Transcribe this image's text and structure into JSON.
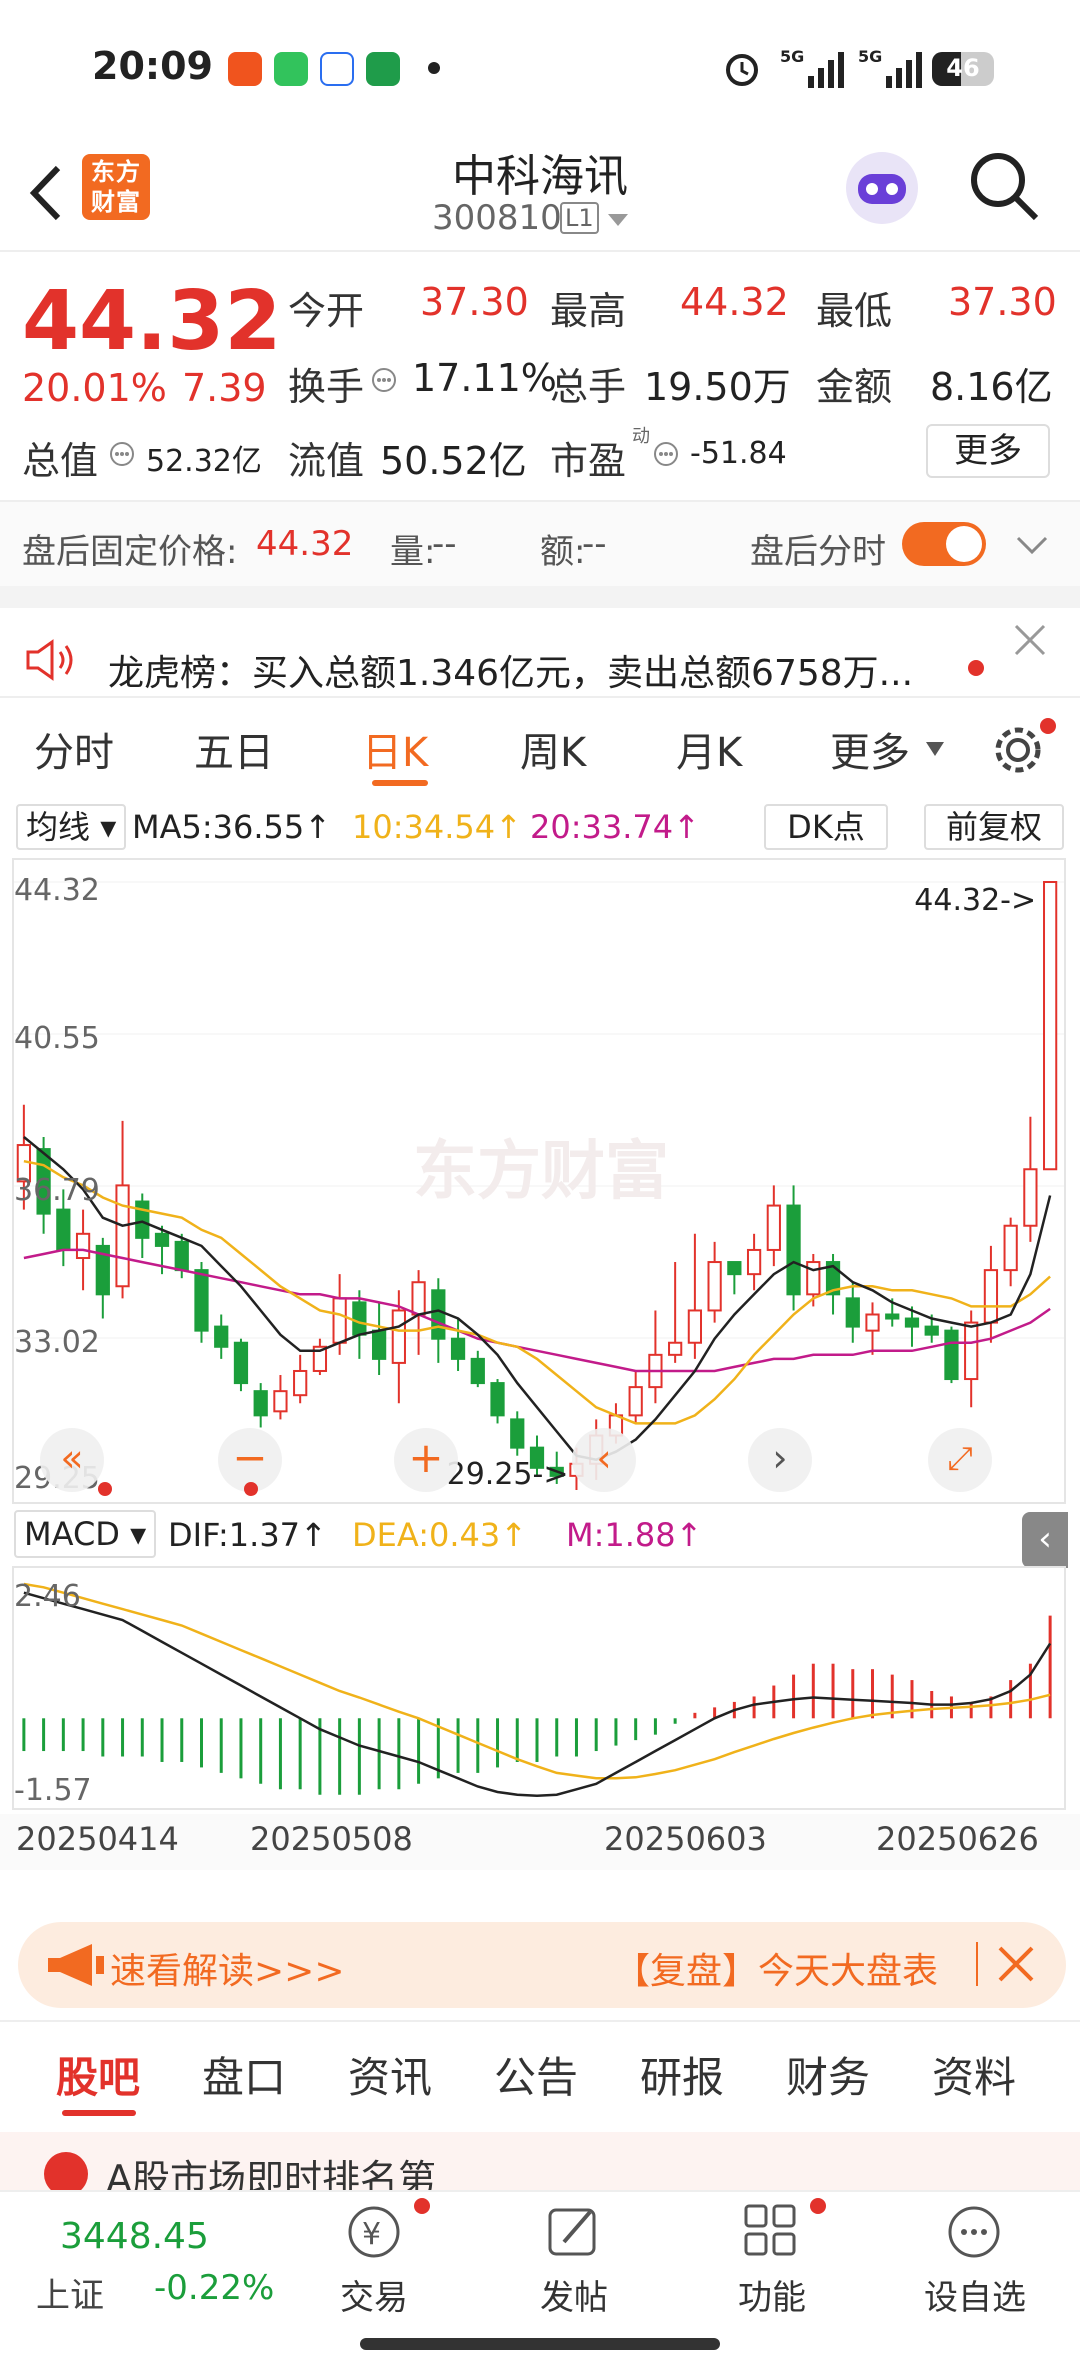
{
  "status": {
    "time": "20:09",
    "battery": "46"
  },
  "header": {
    "logo_text": "东方财富",
    "stock_name": "中科海讯",
    "stock_code": "300810",
    "level_badge": "L1"
  },
  "quote": {
    "price": "44.32",
    "change_pct": "20.01%",
    "change_amt": "7.39",
    "open_label": "今开",
    "open": "37.30",
    "high_label": "最高",
    "high": "44.32",
    "low_label": "最低",
    "low": "37.30",
    "turnover_label": "换手",
    "turnover": "17.11%",
    "volume_label": "总手",
    "volume": "19.50万",
    "amount_label": "金额",
    "amount": "8.16亿",
    "mktcap_label": "总值",
    "mktcap": "52.32亿",
    "float_label": "流值",
    "float_cap": "50.52亿",
    "pe_label": "市盈",
    "pe_sup": "动",
    "pe": "-51.84",
    "more_button": "更多"
  },
  "afterhours": {
    "label": "盘后固定价格:",
    "price": "44.32",
    "vol_label": "量:",
    "vol": "--",
    "amt_label": "额:",
    "amt": "--",
    "toggle_label": "盘后分时",
    "toggle_on": true
  },
  "notice": {
    "text": "龙虎榜：买入总额1.346亿元，卖出总额6758万..."
  },
  "tabs": [
    {
      "label": "分时",
      "active": false
    },
    {
      "label": "五日",
      "active": false
    },
    {
      "label": "日K",
      "active": true
    },
    {
      "label": "周K",
      "active": false
    },
    {
      "label": "月K",
      "active": false
    },
    {
      "label": "更多",
      "active": false
    }
  ],
  "ma_bar": {
    "select": "均线",
    "ma5": "MA5:36.55↑",
    "ma10": "10:34.54↑",
    "ma20": "20:33.74↑",
    "dk": "DK点",
    "fq": "前复权"
  },
  "chart_data": {
    "type": "candlestick",
    "watermark": "东方财富",
    "y_ticks": [
      "44.32",
      "40.55",
      "36.79",
      "33.02",
      "29.25"
    ],
    "ylim": [
      29.25,
      44.32
    ],
    "max_label": "44.32->",
    "min_label": "29.25->",
    "x_ticks": [
      "20250414",
      "20250508",
      "20250603",
      "20250626"
    ],
    "candles": [
      [
        36.9,
        37.8,
        38.8,
        36.2
      ],
      [
        37.7,
        36.1,
        38.0,
        35.6
      ],
      [
        36.2,
        35.2,
        36.7,
        34.8
      ],
      [
        35.0,
        35.6,
        36.2,
        34.2
      ],
      [
        35.3,
        34.1,
        35.5,
        33.5
      ],
      [
        34.3,
        36.8,
        38.4,
        34.0
      ],
      [
        36.4,
        35.5,
        36.6,
        35.0
      ],
      [
        35.6,
        35.3,
        35.8,
        34.6
      ],
      [
        35.4,
        34.7,
        35.6,
        34.5
      ],
      [
        34.7,
        33.2,
        34.9,
        32.9
      ],
      [
        33.3,
        32.8,
        33.6,
        32.5
      ],
      [
        32.9,
        31.9,
        33.0,
        31.7
      ],
      [
        31.7,
        31.1,
        31.9,
        30.8
      ],
      [
        31.2,
        31.7,
        32.1,
        31.0
      ],
      [
        31.6,
        32.2,
        32.6,
        31.4
      ],
      [
        32.2,
        32.8,
        33.0,
        32.1
      ],
      [
        32.9,
        34.0,
        34.6,
        32.6
      ],
      [
        33.9,
        33.1,
        34.2,
        32.5
      ],
      [
        33.2,
        32.5,
        33.9,
        32.1
      ],
      [
        32.4,
        33.7,
        34.2,
        31.4
      ],
      [
        33.6,
        34.4,
        34.7,
        32.6
      ],
      [
        34.2,
        33.0,
        34.5,
        32.4
      ],
      [
        33.0,
        32.5,
        33.5,
        32.2
      ],
      [
        32.5,
        31.9,
        32.7,
        31.8
      ],
      [
        31.9,
        31.1,
        32.0,
        30.9
      ],
      [
        31.0,
        30.3,
        31.2,
        30.1
      ],
      [
        30.3,
        29.8,
        30.6,
        29.6
      ],
      [
        29.8,
        29.6,
        30.2,
        29.4
      ],
      [
        29.6,
        29.9,
        30.3,
        29.25
      ],
      [
        29.9,
        30.6,
        31.0,
        29.5
      ],
      [
        30.6,
        31.1,
        31.4,
        30.4
      ],
      [
        31.1,
        31.8,
        32.2,
        30.9
      ],
      [
        31.8,
        32.6,
        33.7,
        31.4
      ],
      [
        32.6,
        32.9,
        34.9,
        32.4
      ],
      [
        32.9,
        33.7,
        35.6,
        32.5
      ],
      [
        33.7,
        34.9,
        35.4,
        33.4
      ],
      [
        34.9,
        34.6,
        34.9,
        34.1
      ],
      [
        34.6,
        35.2,
        35.6,
        34.2
      ],
      [
        35.2,
        36.3,
        36.8,
        34.8
      ],
      [
        36.3,
        34.1,
        36.8,
        33.7
      ],
      [
        34.1,
        34.9,
        35.1,
        33.8
      ],
      [
        34.9,
        34.1,
        35.1,
        33.6
      ],
      [
        34.0,
        33.3,
        34.4,
        32.9
      ],
      [
        33.2,
        33.6,
        33.9,
        32.6
      ],
      [
        33.6,
        33.5,
        34.0,
        33.3
      ],
      [
        33.5,
        33.3,
        33.8,
        32.8
      ],
      [
        33.3,
        33.1,
        33.6,
        32.9
      ],
      [
        33.2,
        32.0,
        33.3,
        31.9
      ],
      [
        32.0,
        33.4,
        33.7,
        31.3
      ],
      [
        33.4,
        34.7,
        35.3,
        32.9
      ],
      [
        34.7,
        35.8,
        36.0,
        34.3
      ],
      [
        35.8,
        37.2,
        38.5,
        35.4
      ],
      [
        37.2,
        44.32,
        44.32,
        37.3
      ]
    ],
    "ma5": [
      38.0,
      37.6,
      37.2,
      36.7,
      36.0,
      35.8,
      35.9,
      35.7,
      35.5,
      35.3,
      34.8,
      34.3,
      33.7,
      33.1,
      32.7,
      32.7,
      32.9,
      33.1,
      33.2,
      33.3,
      33.6,
      33.7,
      33.5,
      33.1,
      32.6,
      31.9,
      31.3,
      30.7,
      30.1,
      30.0,
      30.2,
      30.5,
      31.0,
      31.6,
      32.2,
      33.0,
      33.6,
      34.1,
      34.6,
      34.9,
      34.7,
      34.8,
      34.4,
      34.2,
      33.9,
      33.7,
      33.5,
      33.4,
      33.3,
      33.4,
      33.6,
      34.6,
      36.55
    ],
    "ma10": [
      37.4,
      37.3,
      37.0,
      36.8,
      36.5,
      36.3,
      36.2,
      36.1,
      36.0,
      35.7,
      35.5,
      35.1,
      34.7,
      34.3,
      34.0,
      33.7,
      33.6,
      33.4,
      33.3,
      33.2,
      33.2,
      33.3,
      33.2,
      33.1,
      32.9,
      32.8,
      32.5,
      32.1,
      31.7,
      31.3,
      31.1,
      30.9,
      30.9,
      30.9,
      31.1,
      31.5,
      32.0,
      32.6,
      33.1,
      33.6,
      34.0,
      34.2,
      34.3,
      34.3,
      34.2,
      34.2,
      34.1,
      34.0,
      33.8,
      33.8,
      33.8,
      34.1,
      34.54
    ],
    "ma20": [
      35.0,
      35.1,
      35.2,
      35.2,
      35.1,
      35.0,
      34.9,
      34.8,
      34.7,
      34.6,
      34.5,
      34.4,
      34.3,
      34.2,
      34.1,
      34.1,
      34.0,
      34.0,
      33.9,
      33.8,
      33.6,
      33.4,
      33.2,
      33.0,
      32.9,
      32.8,
      32.7,
      32.6,
      32.5,
      32.4,
      32.3,
      32.2,
      32.2,
      32.2,
      32.2,
      32.2,
      32.3,
      32.4,
      32.5,
      32.5,
      32.6,
      32.6,
      32.6,
      32.7,
      32.7,
      32.7,
      32.8,
      32.9,
      32.9,
      33.0,
      33.2,
      33.4,
      33.74
    ]
  },
  "macd_bar": {
    "select": "MACD",
    "dif": "DIF:1.37↑",
    "dea": "DEA:0.43↑",
    "m": "M:1.88↑"
  },
  "macd_data": {
    "y_ticks": [
      "2.46",
      "-1.57"
    ],
    "ylim": [
      -1.57,
      2.46
    ],
    "hist": [
      -0.6,
      -0.6,
      -0.6,
      -0.6,
      -0.7,
      -0.7,
      -0.7,
      -0.8,
      -0.8,
      -0.9,
      -1.0,
      -1.1,
      -1.2,
      -1.3,
      -1.3,
      -1.4,
      -1.4,
      -1.4,
      -1.3,
      -1.3,
      -1.2,
      -1.1,
      -1.0,
      -1.0,
      -0.9,
      -0.8,
      -0.8,
      -0.7,
      -0.7,
      -0.6,
      -0.5,
      -0.4,
      -0.3,
      -0.1,
      0.1,
      0.2,
      0.3,
      0.4,
      0.6,
      0.8,
      1.0,
      1.0,
      0.9,
      0.9,
      0.8,
      0.7,
      0.5,
      0.4,
      0.3,
      0.4,
      0.7,
      1.0,
      1.88
    ],
    "dif": [
      2.3,
      2.2,
      2.1,
      2.0,
      1.9,
      1.8,
      1.6,
      1.4,
      1.2,
      1.0,
      0.8,
      0.6,
      0.4,
      0.2,
      0.0,
      -0.2,
      -0.35,
      -0.5,
      -0.6,
      -0.7,
      -0.8,
      -0.95,
      -1.1,
      -1.25,
      -1.35,
      -1.4,
      -1.42,
      -1.4,
      -1.3,
      -1.2,
      -1.0,
      -0.8,
      -0.6,
      -0.4,
      -0.2,
      0.0,
      0.15,
      0.25,
      0.3,
      0.35,
      0.38,
      0.36,
      0.34,
      0.32,
      0.3,
      0.28,
      0.25,
      0.25,
      0.28,
      0.35,
      0.5,
      0.8,
      1.37
    ],
    "dea": [
      2.46,
      2.4,
      2.3,
      2.2,
      2.1,
      2.0,
      1.9,
      1.8,
      1.7,
      1.55,
      1.4,
      1.25,
      1.1,
      0.95,
      0.8,
      0.65,
      0.5,
      0.38,
      0.25,
      0.12,
      0.0,
      -0.15,
      -0.3,
      -0.45,
      -0.6,
      -0.75,
      -0.88,
      -1.0,
      -1.05,
      -1.1,
      -1.1,
      -1.08,
      -1.02,
      -0.95,
      -0.85,
      -0.75,
      -0.62,
      -0.5,
      -0.38,
      -0.27,
      -0.17,
      -0.08,
      0.0,
      0.06,
      0.1,
      0.14,
      0.17,
      0.19,
      0.21,
      0.24,
      0.28,
      0.34,
      0.43
    ]
  },
  "banner": {
    "ticker_text": "速看解读>>>",
    "tag": "【复盘】今天大盘表"
  },
  "bottom_tabs": [
    {
      "label": "股吧",
      "active": true
    },
    {
      "label": "盘口",
      "active": false
    },
    {
      "label": "资讯",
      "active": false
    },
    {
      "label": "公告",
      "active": false
    },
    {
      "label": "研报",
      "active": false
    },
    {
      "label": "财务",
      "active": false
    },
    {
      "label": "资料",
      "active": false
    }
  ],
  "peek_text": "A股市场即时排名第",
  "nav": {
    "index_value": "3448.45",
    "index_name": "上证",
    "index_change": "-0.22%",
    "trade": "交易",
    "post": "发帖",
    "func": "功能",
    "watch": "设自选"
  },
  "colors": {
    "up": "#e2322b",
    "down": "#1b9e3b",
    "ma5": "#222222",
    "ma10": "#f0b21a",
    "ma20": "#c21b8a",
    "accent": "#f26a21"
  }
}
